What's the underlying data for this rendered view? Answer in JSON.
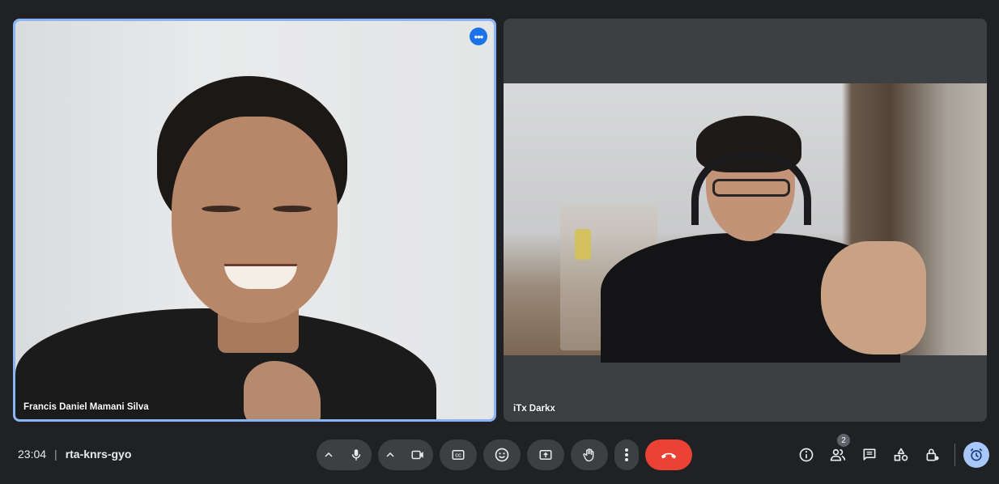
{
  "participants": [
    {
      "name": "Francis Daniel Mamani Silva",
      "active_speaker": true
    },
    {
      "name": "iTx Darkx",
      "active_speaker": false
    }
  ],
  "meeting": {
    "time": "23:04",
    "separator": "|",
    "code": "rta-knrs-gyo"
  },
  "controls": {
    "mic": {
      "icon": "microphone-icon",
      "caret": "^"
    },
    "camera": {
      "icon": "video-camera-icon",
      "caret": "^"
    },
    "captions_icon": "closed-captions-icon",
    "reactions_icon": "emoji-icon",
    "present_icon": "present-screen-icon",
    "raise_hand_icon": "raise-hand-icon",
    "more_icon": "more-vert-icon",
    "end_call_icon": "end-call-icon"
  },
  "side_tools": {
    "info_icon": "info-icon",
    "people_icon": "people-icon",
    "people_count": "2",
    "chat_icon": "chat-icon",
    "activities_icon": "activities-icon",
    "host_controls_icon": "host-lock-icon",
    "avatar_icon": "alarm-avatar-icon"
  },
  "colors": {
    "accent": "#8ab4f8",
    "end_call": "#ea4335",
    "bg": "#202124",
    "button": "#3c4043"
  }
}
